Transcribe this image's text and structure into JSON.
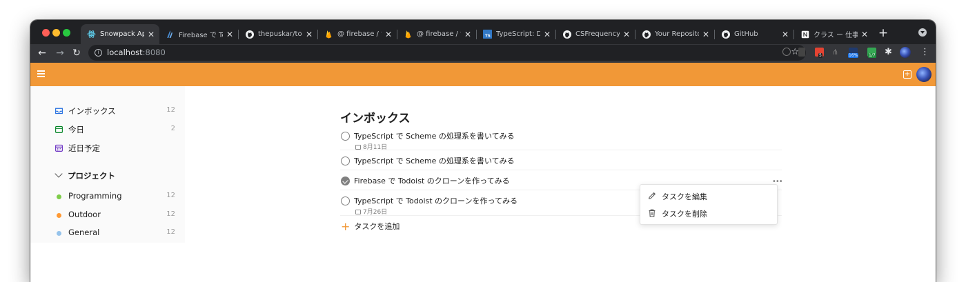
{
  "browser": {
    "tabs": [
      {
        "title": "Snowpack App",
        "favicon": "react-icon",
        "active": true
      },
      {
        "title": "Firebase で Tod",
        "favicon": "firebase-angle-icon",
        "active": false
      },
      {
        "title": "thepuskar/todo",
        "favicon": "github-icon",
        "active": false
      },
      {
        "title": "@ firebase / fir",
        "favicon": "firebase-flame-icon",
        "active": false
      },
      {
        "title": "@ firebase / fir",
        "favicon": "firebase-flame-icon",
        "active": false
      },
      {
        "title": "TypeScript: Do",
        "favicon": "typescript-icon",
        "active": false
      },
      {
        "title": "CSFrequency/",
        "favicon": "github-icon",
        "active": false
      },
      {
        "title": "Your Reposito",
        "favicon": "github-icon",
        "active": false
      },
      {
        "title": "GitHub",
        "favicon": "github-icon",
        "active": false
      },
      {
        "title": "クラス ー 仕事で",
        "favicon": "notion-icon",
        "active": false
      }
    ],
    "new_tab_label": "+",
    "url_host": "localhost",
    "url_port": ":8080",
    "extension_badges": {
      "todoist": "5",
      "ext_b": "16%",
      "ext_c": "1/7"
    }
  },
  "sidebar": {
    "items": [
      {
        "label": "インボックス",
        "count": "12",
        "icon": "inbox-icon",
        "color": "#246fe0"
      },
      {
        "label": "今日",
        "count": "2",
        "icon": "calendar-today-icon",
        "color": "#058527"
      },
      {
        "label": "近日予定",
        "count": "",
        "icon": "calendar-upcoming-icon",
        "color": "#692fc2"
      }
    ],
    "projects_header": "プロジェクト",
    "projects": [
      {
        "label": "Programming",
        "count": "12",
        "color": "#7ecc49"
      },
      {
        "label": "Outdoor",
        "count": "12",
        "color": "#ff9933"
      },
      {
        "label": "General",
        "count": "12",
        "color": "#96c3eb"
      }
    ]
  },
  "main": {
    "title": "インボックス",
    "tasks": [
      {
        "text": "TypeScript で Scheme の処理系を書いてみる",
        "date": "8月11日",
        "done": false
      },
      {
        "text": "TypeScript で Scheme の処理系を書いてみる",
        "date": "",
        "done": false
      },
      {
        "text": "Firebase で Todoist のクローンを作ってみる",
        "date": "",
        "done": true
      },
      {
        "text": "TypeScript で Todoist のクローンを作ってみる",
        "date": "7月26日",
        "done": false
      }
    ],
    "more_label": "•••",
    "add_task_label": "タスクを追加"
  },
  "context_menu": {
    "items": [
      {
        "label": "タスクを編集",
        "icon": "pencil-icon"
      },
      {
        "label": "タスクを削除",
        "icon": "trash-icon"
      }
    ]
  },
  "colors": {
    "accent": "#f19837",
    "tab_bg": "#202124",
    "toolbar_bg": "#35363a"
  }
}
